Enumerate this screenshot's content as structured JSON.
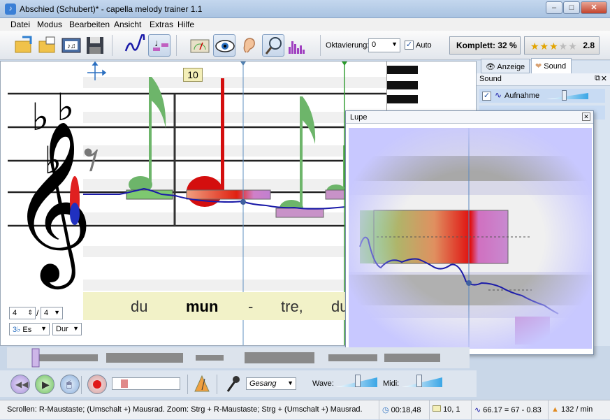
{
  "window": {
    "title": "Abschied (Schubert)* - capella melody trainer 1.1"
  },
  "menu": [
    "Datei",
    "Modus",
    "Bearbeiten",
    "Ansicht",
    "Extras",
    "Hilfe"
  ],
  "toolbar": {
    "octave_label": "Oktavierung:",
    "octave_value": "0",
    "auto_label": "Auto",
    "auto_checked": true,
    "complete_label": "Komplett: 32 %",
    "stars": 2.5,
    "rating_value": "2.8"
  },
  "score": {
    "measure_number": "10",
    "time_sig_num": "4",
    "time_sig_den": "4",
    "key": "Es",
    "mode": "Dur",
    "lyrics": [
      "du",
      "mun",
      "-",
      "tre,",
      "du"
    ]
  },
  "panel": {
    "tabs": [
      "Anzeige",
      "Sound"
    ],
    "section_title": "Sound",
    "rows": [
      {
        "label": "Aufnahme",
        "checked": true
      },
      {
        "label": "",
        "checked": true
      }
    ]
  },
  "lupe": {
    "title": "Lupe"
  },
  "controls": {
    "instrument": "Gesang",
    "wave_label": "Wave:",
    "midi_label": "Midi:"
  },
  "status": {
    "hint": "Scrollen: R-Maustaste; (Umschalt +) Mausrad.  Zoom: Strg + R-Maustaste; Strg + (Umschalt +) Mausrad.",
    "time": "00:18,48",
    "position": "10, 1",
    "pitch": "66.17 = 67 - 0.83",
    "tempo": "132 / min"
  },
  "colors": {
    "accent": "#3a7fd6",
    "note_green": "#5fb35a",
    "note_red": "#d40e0e",
    "pitch_curve": "#1a1aa8"
  }
}
